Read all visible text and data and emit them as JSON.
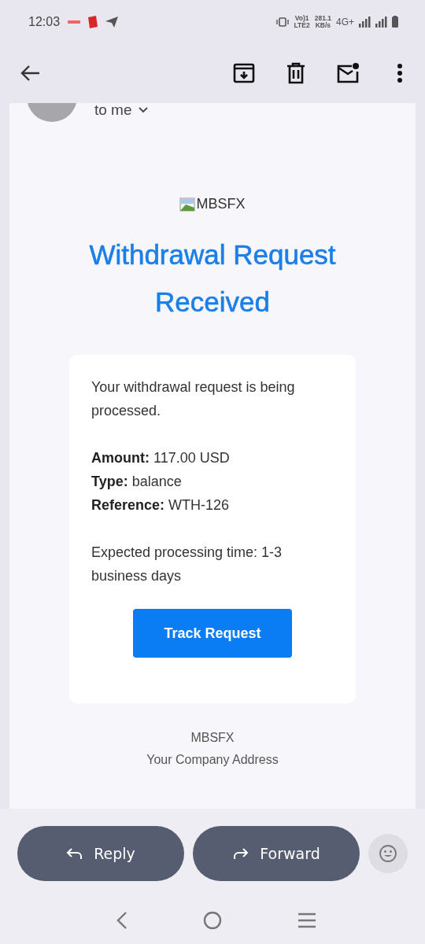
{
  "status_bar": {
    "time": "12:03",
    "volte": "Vo)1",
    "lte": "LTE2",
    "speed": "281.1",
    "speed_unit": "KB/s",
    "network": "4G+"
  },
  "toolbar": {
    "actions": [
      {
        "kind": "archive"
      },
      {
        "kind": "delete"
      },
      {
        "kind": "unread"
      },
      {
        "kind": "more"
      }
    ]
  },
  "message": {
    "recipient": "to me",
    "logo_alt": "MBSFX",
    "title": "Withdrawal Request Received",
    "paragraphs": [
      "Your withdrawal request is being processed."
    ],
    "details": [
      "**Amount:** 117.00 USD",
      "**Type:** balance",
      "**Reference:** WTH-126"
    ],
    "note": "Expected processing time: 1-3 business days",
    "button": "Track Request",
    "footer": [
      "MBSFX",
      "Your Company Address"
    ]
  },
  "actions": [
    {
      "kind": "reply",
      "label": "Reply"
    },
    {
      "kind": "forward",
      "label": "Forward"
    }
  ]
}
